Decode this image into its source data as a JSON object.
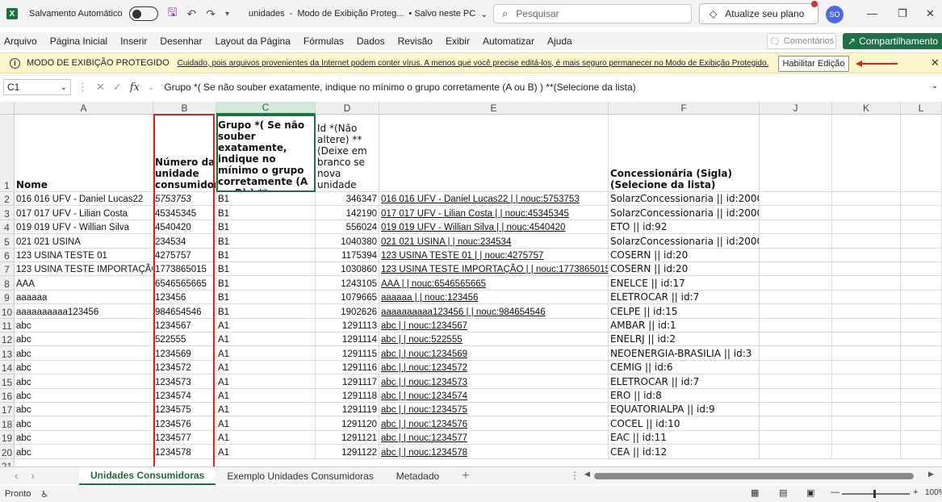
{
  "titlebar": {
    "autosave_label": "Salvamento Automático",
    "file_name": "unidades",
    "separator": "-",
    "mode": "Modo de Exibição Proteg...",
    "save_state": "• Salvo neste PC",
    "search_placeholder": "Pesquisar",
    "upgrade_label": "Atualize seu plano",
    "avatar_initials": "SO"
  },
  "ribbon": {
    "tabs": [
      "Arquivo",
      "Página Inicial",
      "Inserir",
      "Desenhar",
      "Layout da Página",
      "Fórmulas",
      "Dados",
      "Revisão",
      "Exibir",
      "Automatizar",
      "Ajuda"
    ],
    "comments_label": "Comentários",
    "share_label": "Compartilhamento"
  },
  "protected_view": {
    "title": "MODO DE EXIBIÇÃO PROTEGIDO",
    "message": "Cuidado, pois arquivos provenientes da Internet podem conter vírus. A menos que você precise editá-los, é mais seguro permanecer no Modo de  Exibição Protegido.",
    "enable_label": "Habilitar Edição"
  },
  "formula_bar": {
    "cell_ref": "C1",
    "content": "Grupo *( Se não souber exatamente, indique no mínimo o grupo corretamente (A ou B) )  **(Selecione da lista)"
  },
  "grid": {
    "columns": [
      "A",
      "B",
      "C",
      "D",
      "E",
      "F",
      "J",
      "K",
      "L"
    ],
    "row_numbers": [
      "1",
      "2",
      "3",
      "4",
      "5",
      "6",
      "7",
      "8",
      "9",
      "10",
      "11",
      "12",
      "13",
      "14",
      "15",
      "16",
      "17",
      "18",
      "19",
      "20",
      "21"
    ],
    "headers": {
      "a": "Nome",
      "b": "Número da unidade consumidora",
      "c": "Grupo *( Se não souber exatamente, indique no mínimo o grupo corretamente (A ou B) ) **(Selecione da lista)",
      "d": "Id *(Não altere) **(Deixe em branco se nova unidade",
      "e": "",
      "f": "Concessionária (Sigla) (Selecione da lista)"
    },
    "rows": [
      {
        "a": "016 016 UFV - Daniel Lucas22",
        "b": "5753753",
        "c": "B1",
        "d": "346347",
        "e": "016 016 UFV - Daniel Lucas22 | | nouc:5753753",
        "f": "SolarzConcessionaria || id:2000"
      },
      {
        "a": "017 017 UFV - Lilian Costa",
        "b": "45345345",
        "c": "B1",
        "d": "142190",
        "e": "017 017 UFV - Lilian Costa | | nouc:45345345",
        "f": "SolarzConcessionaria || id:2000"
      },
      {
        "a": "019 019 UFV - Willian Silva",
        "b": "4540420",
        "c": "B1",
        "d": "556024",
        "e": "019 019 UFV - Willian Silva | | nouc:4540420",
        "f": "ETO || id:92"
      },
      {
        "a": "021 021 USINA",
        "b": "234534",
        "c": "B1",
        "d": "1040380",
        "e": "021 021 USINA | | nouc:234534",
        "f": "SolarzConcessionaria || id:2000"
      },
      {
        "a": "123 USINA TESTE 01",
        "b": "4275757",
        "c": "B1",
        "d": "1175394",
        "e": "123 USINA TESTE 01 | | nouc:4275757",
        "f": "COSERN || id:20"
      },
      {
        "a": "123 USINA TESTE IMPORTAÇÃO",
        "b": "1773865015",
        "c": "B1",
        "d": "1030860",
        "e": "123 USINA TESTE IMPORTAÇÃO | | nouc:1773865015",
        "f": "COSERN || id:20"
      },
      {
        "a": "AAA",
        "b": "6546565665",
        "c": "B1",
        "d": "1243105",
        "e": "AAA | | nouc:6546565665",
        "f": "ENELCE || id:17"
      },
      {
        "a": "aaaaaa",
        "b": "123456",
        "c": "B1",
        "d": "1079665",
        "e": "aaaaaa | | nouc:123456",
        "f": "ELETROCAR || id:7"
      },
      {
        "a": "aaaaaaaaaa123456",
        "b": "984654546",
        "c": "B1",
        "d": "1902626",
        "e": "aaaaaaaaaa123456 | | nouc:984654546",
        "f": "CELPE || id:15"
      },
      {
        "a": "abc",
        "b": "1234567",
        "c": "A1",
        "d": "1291113",
        "e": "abc | | nouc:1234567",
        "f": "AMBAR || id:1"
      },
      {
        "a": "abc",
        "b": "522555",
        "c": "A1",
        "d": "1291114",
        "e": "abc | | nouc:522555",
        "f": "ENELRJ || id:2"
      },
      {
        "a": "abc",
        "b": "1234569",
        "c": "A1",
        "d": "1291115",
        "e": "abc | | nouc:1234569",
        "f": "NEOENERGIA-BRASILIA || id:3"
      },
      {
        "a": "abc",
        "b": "1234572",
        "c": "A1",
        "d": "1291116",
        "e": "abc | | nouc:1234572",
        "f": "CEMIG || id:6"
      },
      {
        "a": "abc",
        "b": "1234573",
        "c": "A1",
        "d": "1291117",
        "e": "abc | | nouc:1234573",
        "f": "ELETROCAR || id:7"
      },
      {
        "a": "abc",
        "b": "1234574",
        "c": "A1",
        "d": "1291118",
        "e": "abc | | nouc:1234574",
        "f": "ERO || id:8"
      },
      {
        "a": "abc",
        "b": "1234575",
        "c": "A1",
        "d": "1291119",
        "e": "abc | | nouc:1234575",
        "f": "EQUATORIALPA || id:9"
      },
      {
        "a": "abc",
        "b": "1234576",
        "c": "A1",
        "d": "1291120",
        "e": "abc | | nouc:1234576",
        "f": "COCEL || id:10"
      },
      {
        "a": "abc",
        "b": "1234577",
        "c": "A1",
        "d": "1291121",
        "e": "abc | | nouc:1234577",
        "f": "EAC || id:11"
      },
      {
        "a": "abc",
        "b": "1234578",
        "c": "A1",
        "d": "1291122",
        "e": "abc | | nouc:1234578",
        "f": "CEA || id:12"
      }
    ]
  },
  "sheets": {
    "tabs": [
      "Unidades Consumidoras",
      "Exemplo Unidades Consumidoras",
      "Metadado"
    ],
    "active": "Unidades Consumidoras"
  },
  "status": {
    "ready": "Pronto",
    "zoom": "100%"
  },
  "colors": {
    "excel_green": "#1e7145",
    "protected_bg": "#fdf6cc",
    "highlight_red": "#e0201f",
    "avatar_blue": "#4d6bde"
  }
}
